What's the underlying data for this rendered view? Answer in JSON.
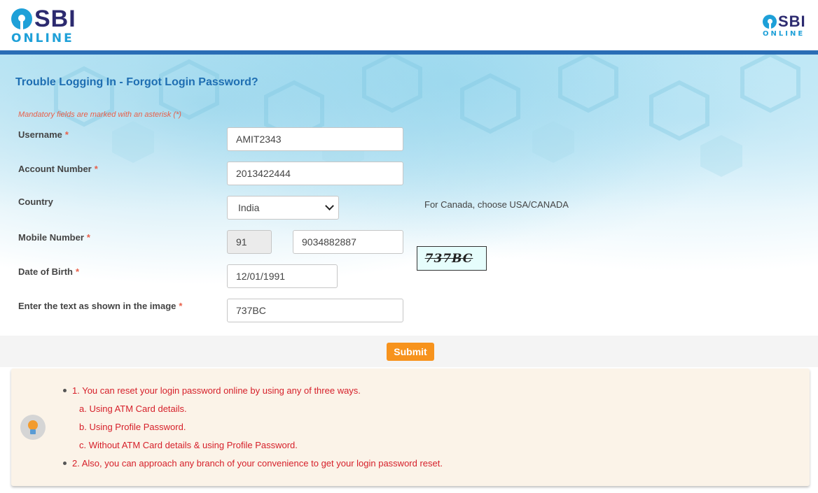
{
  "header": {
    "logo_text": "SBI",
    "logo_subtext": "ONLINE",
    "accent_color": "#2a6db5"
  },
  "form": {
    "title": "Trouble Logging In - Forgot Login Password?",
    "mandatory_note": "Mandatory fields are marked with an asterisk (*)",
    "asterisk": "*",
    "fields": {
      "username": {
        "label": "Username",
        "value": "AMIT2343"
      },
      "account_number": {
        "label": "Account Number",
        "value": "2013422444"
      },
      "country": {
        "label": "Country",
        "value": "India",
        "hint": "For Canada, choose USA/CANADA"
      },
      "mobile_number": {
        "label": "Mobile Number",
        "country_code": "91",
        "value": "9034882887"
      },
      "date_of_birth": {
        "label": "Date of Birth",
        "value": "12/01/1991"
      },
      "captcha": {
        "label": "Enter the text as shown in the image",
        "value": "737BC",
        "image_text": "737BC"
      }
    },
    "submit_label": "Submit",
    "submit_color": "#f7931d"
  },
  "info": {
    "icon": "lightbulb-icon",
    "lines": [
      "1. You can reset your login password online by using any of three ways.",
      "a. Using ATM Card details.",
      "b. Using Profile Password.",
      "c. Without ATM Card details & using Profile Password.",
      "2. Also, you can approach any branch of your convenience to get your login password reset."
    ],
    "text_color": "#d6202a"
  }
}
